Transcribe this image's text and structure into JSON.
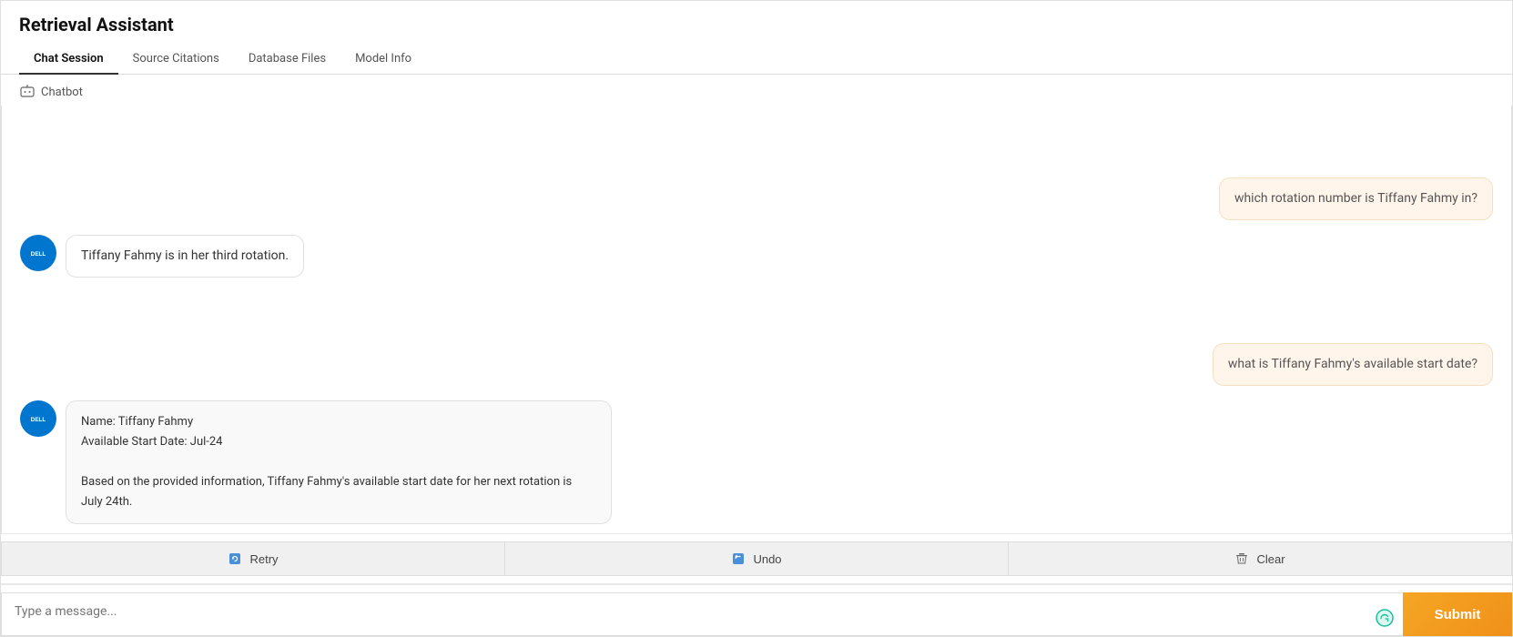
{
  "app": {
    "title": "Retrieval Assistant"
  },
  "tabs": [
    {
      "id": "chat-session",
      "label": "Chat Session",
      "active": true
    },
    {
      "id": "source-citations",
      "label": "Source Citations",
      "active": false
    },
    {
      "id": "database-files",
      "label": "Database Files",
      "active": false
    },
    {
      "id": "model-info",
      "label": "Model Info",
      "active": false
    }
  ],
  "chatbot_label": "Chatbot",
  "messages": [
    {
      "id": "m1",
      "role": "user",
      "text": "which rotation number is Tiffany Fahmy in?"
    },
    {
      "id": "m2",
      "role": "bot",
      "text": "Tiffany Fahmy is in her third rotation."
    },
    {
      "id": "m3",
      "role": "user",
      "text": "what is Tiffany Fahmy's available start date?"
    },
    {
      "id": "m4",
      "role": "bot",
      "text": "Name: Tiffany Fahmy\nAvailable Start Date: Jul-24\n\nBased on the provided information, Tiffany Fahmy's available start date for her next rotation is July 24th."
    }
  ],
  "actions": {
    "retry_label": "Retry",
    "undo_label": "Undo",
    "clear_label": "Clear"
  },
  "input": {
    "placeholder": "Type a message...",
    "submit_label": "Submit"
  },
  "colors": {
    "user_bubble_bg": "#fff5eb",
    "user_bubble_border": "#f5dfc0",
    "bot_bubble_bg": "#ffffff",
    "submit_bg": "#f5a623",
    "accent": "#0076ce"
  }
}
